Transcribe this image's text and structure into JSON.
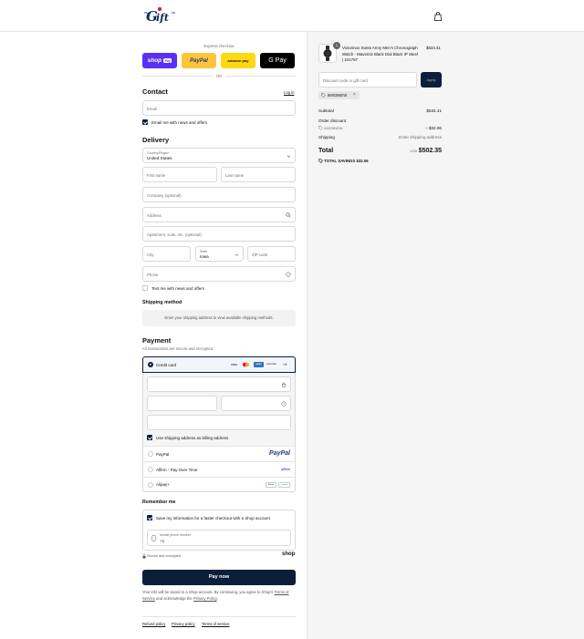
{
  "header": {
    "logo_text": "Gift",
    "logo_badge_top": "VB",
    "logo_badge_right": "CO"
  },
  "express": {
    "title": "Express checkout",
    "or_label": "OR",
    "buttons": [
      {
        "name": "shop-pay",
        "label": "shop",
        "badge": "Pay",
        "bg": "#5a31f4",
        "fg": "#ffffff"
      },
      {
        "name": "paypal",
        "label": "PayPal",
        "bg": "#ffc439",
        "fg": "#253b80"
      },
      {
        "name": "amazon-pay",
        "label": "amazon pay",
        "bg": "#ffd814",
        "fg": "#111111"
      },
      {
        "name": "google-pay",
        "label": "G Pay",
        "bg": "#000000",
        "fg": "#ffffff"
      }
    ]
  },
  "contact": {
    "title": "Contact",
    "login_link": "Log in",
    "email_placeholder": "Email",
    "news_label": "Email me with news and offers",
    "news_checked": true
  },
  "delivery": {
    "title": "Delivery",
    "country_label": "Country/Region",
    "country_value": "United States",
    "first_name_placeholder": "First name",
    "last_name_placeholder": "Last name",
    "company_placeholder": "Company (optional)",
    "address_placeholder": "Address",
    "apartment_placeholder": "Apartment, suite, etc. (optional)",
    "city_placeholder": "City",
    "state_label": "State",
    "state_value": "Iowa",
    "zip_placeholder": "ZIP code",
    "phone_placeholder": "Phone",
    "text_offers_label": "Text me with news and offers",
    "text_offers_checked": false
  },
  "shipping_method": {
    "title": "Shipping method",
    "message": "Enter your shipping address to view available shipping methods."
  },
  "payment": {
    "title": "Payment",
    "subtitle": "All transactions are secure and encrypted.",
    "credit_card_label": "Credit card",
    "card_brands": [
      "VISA",
      "MC",
      "AMEX",
      "DISCOVER"
    ],
    "more_brands": "+4",
    "billing_label": "Use shipping address as billing address",
    "billing_checked": true,
    "options": [
      {
        "label": "PayPal",
        "logo": "PayPal"
      },
      {
        "label": "Affirm - Pay Over Time",
        "logo": "affirm"
      },
      {
        "label": "Alipay+",
        "logo_a": "Alipay",
        "logo_b": "+ more"
      }
    ]
  },
  "remember": {
    "title": "Remember me",
    "save_label": "Save my information for a faster checkout with a Shop account",
    "save_checked": true,
    "phone_label": "Mobile phone number",
    "phone_value": "+1",
    "secure_label": "Secure and encrypted",
    "shop_brand": "shop"
  },
  "pay_button": "Pay now",
  "terms": {
    "text_a": "Your info will be saved to a Shop account. By continuing, you agree to Shop’s",
    "terms_link": "Terms of Service",
    "text_b": " and acknowledge the ",
    "privacy_link": "Privacy Policy",
    "text_c": "."
  },
  "footer_links": [
    "Refund policy",
    "Privacy policy",
    "Terms of service"
  ],
  "order": {
    "item": {
      "quantity": "1",
      "title_line1": "Victorinox Swiss Army Men's Chronograph",
      "title_line2": "Watch - Maverick Black Dial Black IP Steel",
      "title_line3": "| 241797",
      "price": "$534.41"
    },
    "discount_placeholder": "Discount code or gift card",
    "apply_label": "Apply",
    "applied_code": "6MG5NEW",
    "subtotal_label": "Subtotal",
    "subtotal_value": "$534.41",
    "order_discount_label": "Order discount",
    "discount_code": "6MG5NEW",
    "discount_value": "– $32.06",
    "shipping_label": "Shipping",
    "shipping_value": "Enter shipping address",
    "total_label": "Total",
    "currency": "USD",
    "total_value": "$502.35",
    "savings_label": "TOTAL SAVINGS",
    "savings_value": "$32.06"
  },
  "colors": {
    "navy": "#0b1f3a",
    "border": "#d9d9d9",
    "muted": "#707070",
    "panel": "#f5f5f5"
  }
}
